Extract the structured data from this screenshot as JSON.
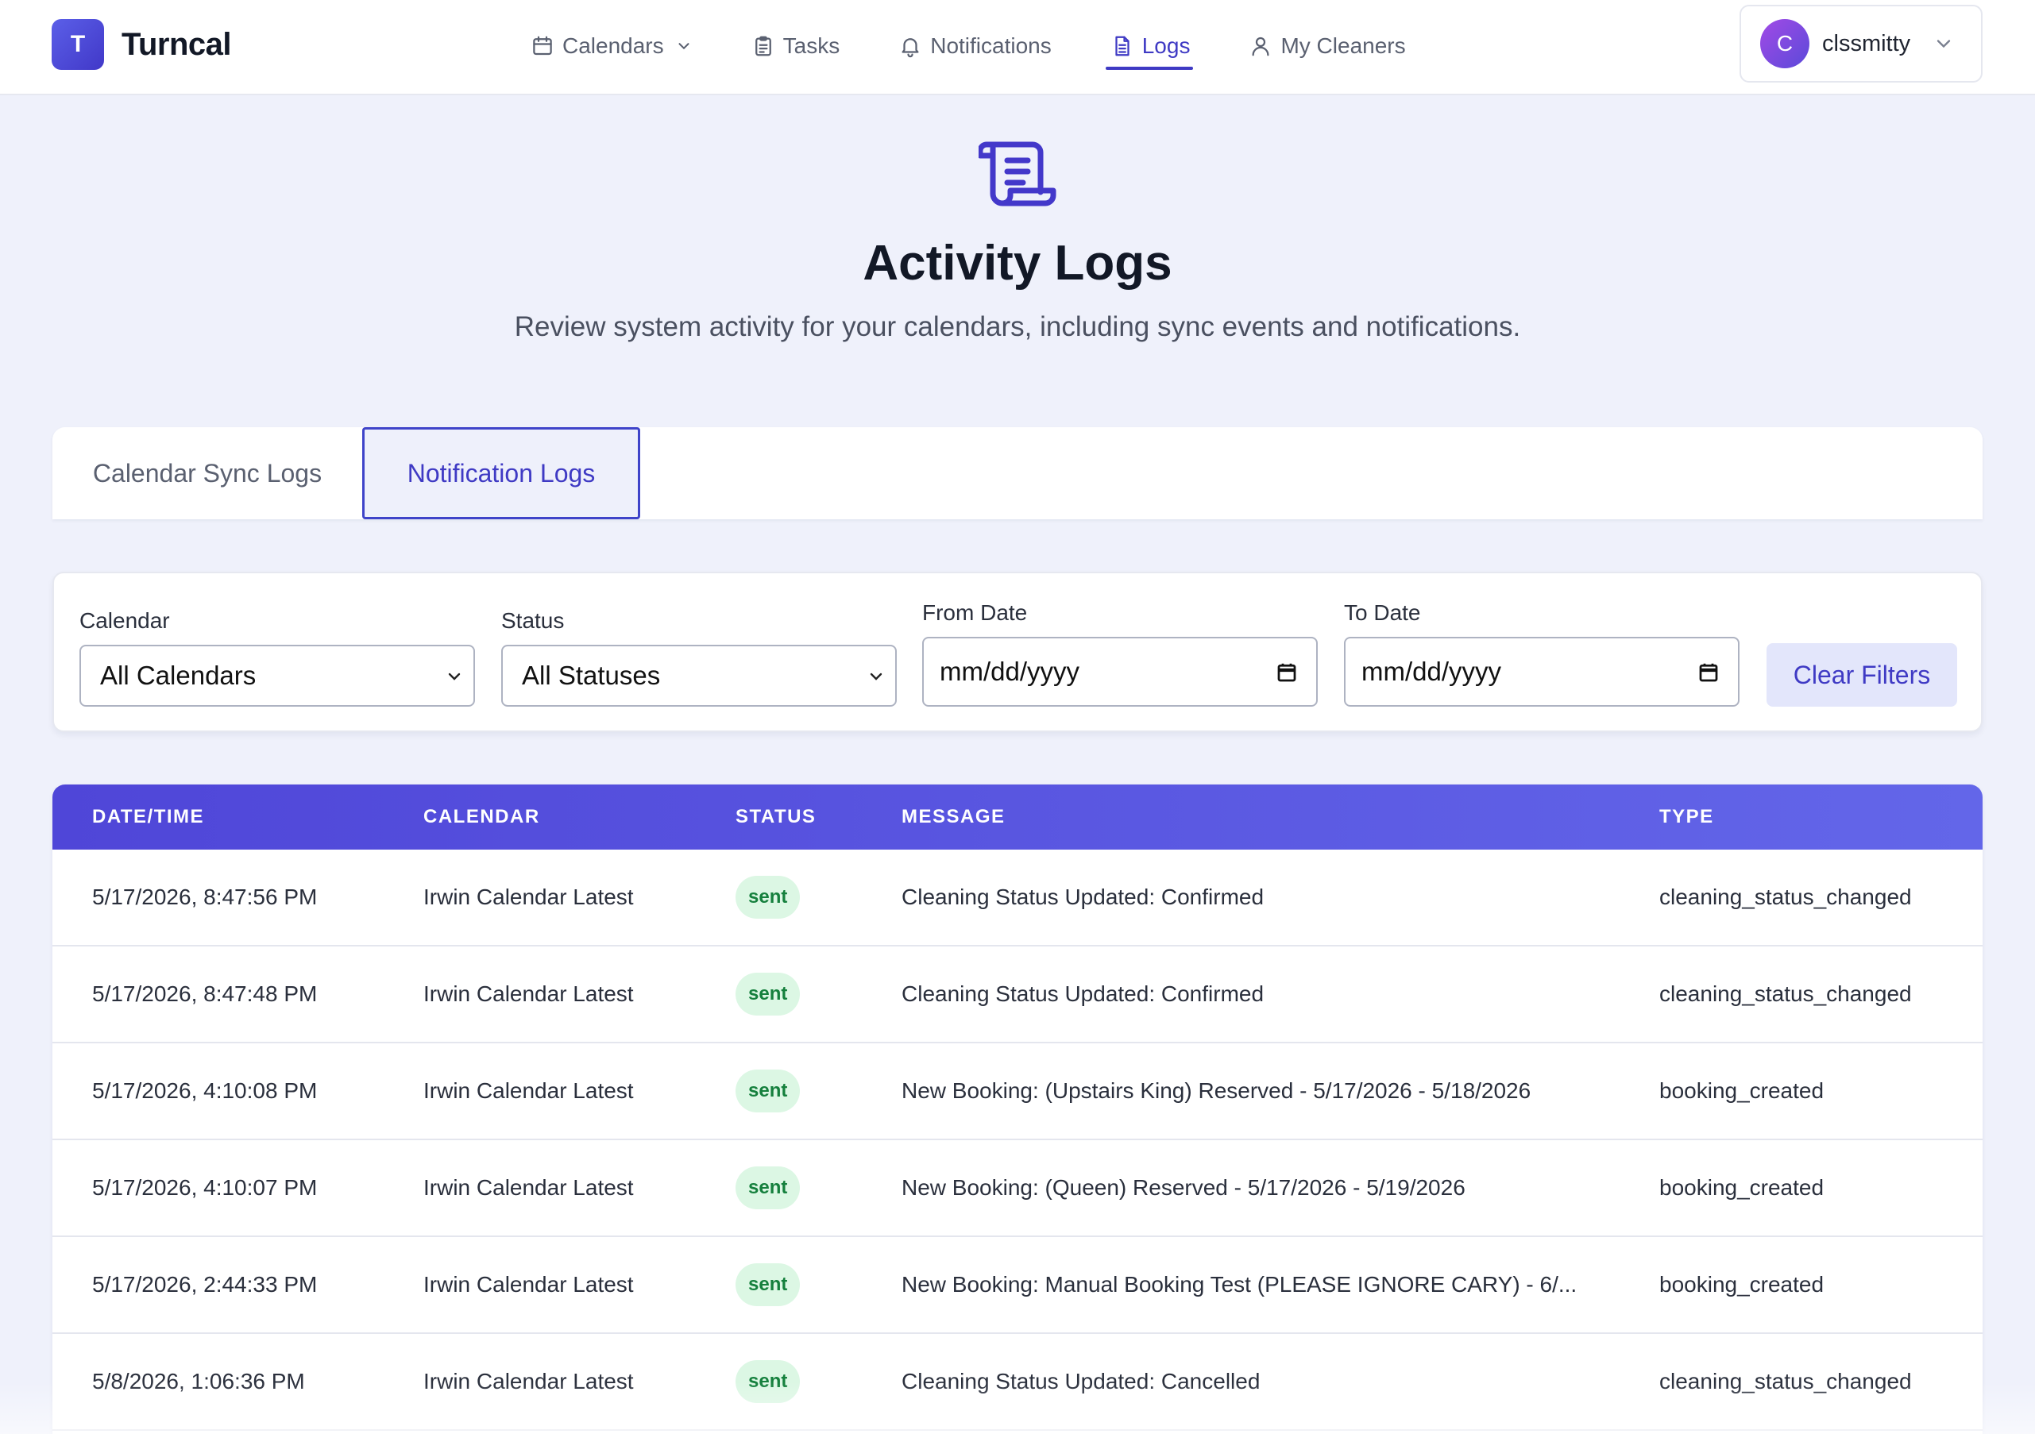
{
  "brand": {
    "logo_letter": "T",
    "name": "Turncal"
  },
  "nav": {
    "items": [
      {
        "label": "Calendars",
        "icon": "calendar-icon"
      },
      {
        "label": "Tasks",
        "icon": "clipboard-icon"
      },
      {
        "label": "Notifications",
        "icon": "bell-icon"
      },
      {
        "label": "Logs",
        "icon": "document-icon",
        "active": true
      },
      {
        "label": "My Cleaners",
        "icon": "user-icon"
      }
    ]
  },
  "user": {
    "avatar_letter": "C",
    "name": "clssmitty"
  },
  "page": {
    "title": "Activity Logs",
    "subtitle": "Review system activity for your calendars, including sync events and notifications."
  },
  "tabs": [
    {
      "label": "Calendar Sync Logs"
    },
    {
      "label": "Notification Logs",
      "active": true
    }
  ],
  "filters": {
    "calendar": {
      "label": "Calendar",
      "value": "All Calendars"
    },
    "status": {
      "label": "Status",
      "value": "All Statuses"
    },
    "from_date": {
      "label": "From Date",
      "value": "mm/dd/yyyy"
    },
    "to_date": {
      "label": "To Date",
      "value": "mm/dd/yyyy"
    },
    "clear_label": "Clear Filters"
  },
  "table": {
    "headers": [
      "DATE/TIME",
      "CALENDAR",
      "STATUS",
      "MESSAGE",
      "TYPE"
    ],
    "rows": [
      {
        "datetime": "5/17/2026, 8:47:56 PM",
        "calendar": "Irwin Calendar Latest",
        "status": "sent",
        "message": "Cleaning Status Updated: Confirmed",
        "type": "cleaning_status_changed"
      },
      {
        "datetime": "5/17/2026, 8:47:48 PM",
        "calendar": "Irwin Calendar Latest",
        "status": "sent",
        "message": "Cleaning Status Updated: Confirmed",
        "type": "cleaning_status_changed"
      },
      {
        "datetime": "5/17/2026, 4:10:08 PM",
        "calendar": "Irwin Calendar Latest",
        "status": "sent",
        "message": "New Booking: (Upstairs King) Reserved - 5/17/2026 - 5/18/2026",
        "type": "booking_created"
      },
      {
        "datetime": "5/17/2026, 4:10:07 PM",
        "calendar": "Irwin Calendar Latest",
        "status": "sent",
        "message": "New Booking: (Queen) Reserved - 5/17/2026 - 5/19/2026",
        "type": "booking_created"
      },
      {
        "datetime": "5/17/2026, 2:44:33 PM",
        "calendar": "Irwin Calendar Latest",
        "status": "sent",
        "message": "New Booking: Manual Booking Test (PLEASE IGNORE CARY) - 6/...",
        "type": "booking_created"
      },
      {
        "datetime": "5/8/2026, 1:06:36 PM",
        "calendar": "Irwin Calendar Latest",
        "status": "sent",
        "message": "Cleaning Status Updated: Cancelled",
        "type": "cleaning_status_changed"
      }
    ]
  },
  "colors": {
    "accent": "#3f3ac4",
    "header_gradient_start": "#4f46d8",
    "header_gradient_end": "#6366e9",
    "status_sent_bg": "#dcf7e4",
    "status_sent_text": "#15803d",
    "page_bg": "#eff1fb"
  }
}
